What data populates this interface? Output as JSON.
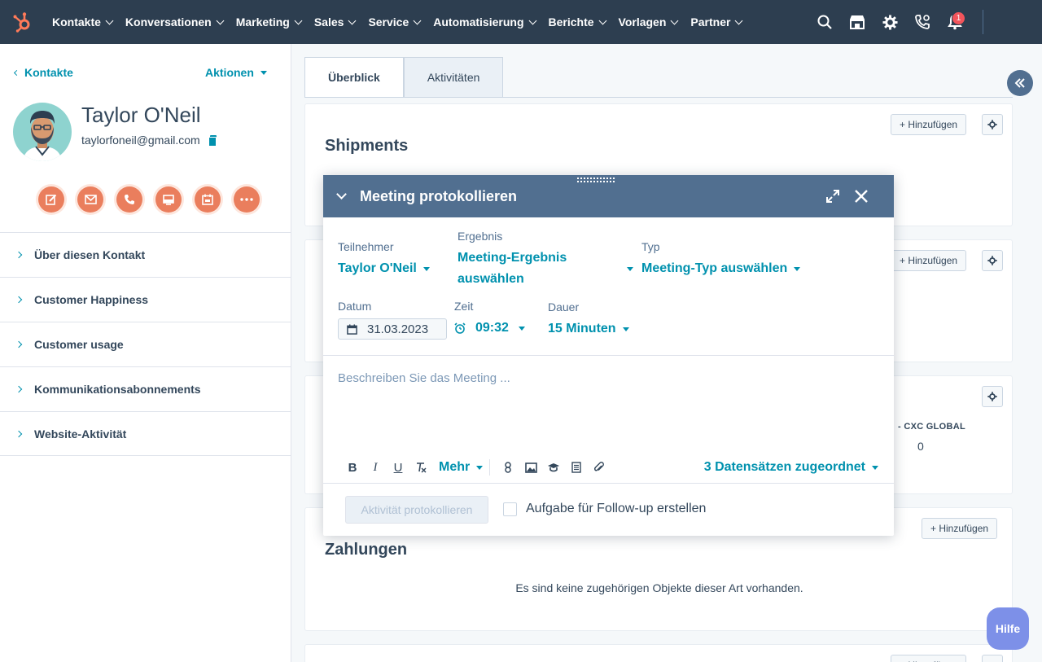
{
  "nav": {
    "items": [
      "Kontakte",
      "Konversationen",
      "Marketing",
      "Sales",
      "Service",
      "Automatisierung",
      "Berichte",
      "Vorlagen",
      "Partner"
    ],
    "notification_count": "1"
  },
  "sidebar": {
    "back_label": "Kontakte",
    "actions_label": "Aktionen",
    "contact": {
      "name": "Taylor O'Neil",
      "email": "taylorfoneil@gmail.com"
    },
    "quick_actions": [
      "note-icon",
      "email-icon",
      "call-icon",
      "log-icon",
      "meeting-icon",
      "more-icon"
    ],
    "sections": [
      "Über diesen Kontakt",
      "Customer Happiness",
      "Customer usage",
      "Kommunikationsabonnements",
      "Website-Aktivität"
    ]
  },
  "tabs": {
    "overview": "Überblick",
    "activities": "Aktivitäten"
  },
  "cards": {
    "add_label": "+ Hinzufügen",
    "shipments_title": "Shipments",
    "cxc_label": "- CXC GLOBAL",
    "cxc_value": "0",
    "payments_title": "Zahlungen",
    "payments_empty": "Es sind keine zugehörigen Objekte dieser Art vorhanden."
  },
  "modal": {
    "title": "Meeting protokollieren",
    "attendee_label": "Teilnehmer",
    "attendee_value": "Taylor O'Neil",
    "outcome_label": "Ergebnis",
    "outcome_value_line1": "Meeting-Ergebnis",
    "outcome_value_line2": "auswählen",
    "type_label": "Typ",
    "type_value": "Meeting-Typ auswählen",
    "date_label": "Datum",
    "date_value": "31.03.2023",
    "time_label": "Zeit",
    "time_value": "09:32",
    "duration_label": "Dauer",
    "duration_value": "15 Minuten",
    "description_placeholder": "Beschreiben Sie das Meeting ...",
    "toolbar_more": "Mehr",
    "associations": "3 Datensätzen zugeordnet",
    "log_button": "Aktivität protokollieren",
    "followup_label": "Aufgabe für Follow-up erstellen"
  },
  "help_label": "Hilfe",
  "colors": {
    "nav_bg": "#2d3e50",
    "accent": "#0091ae",
    "quick_action": "#ea7e5d",
    "modal_header": "#516f90",
    "help": "#7d90e8"
  }
}
